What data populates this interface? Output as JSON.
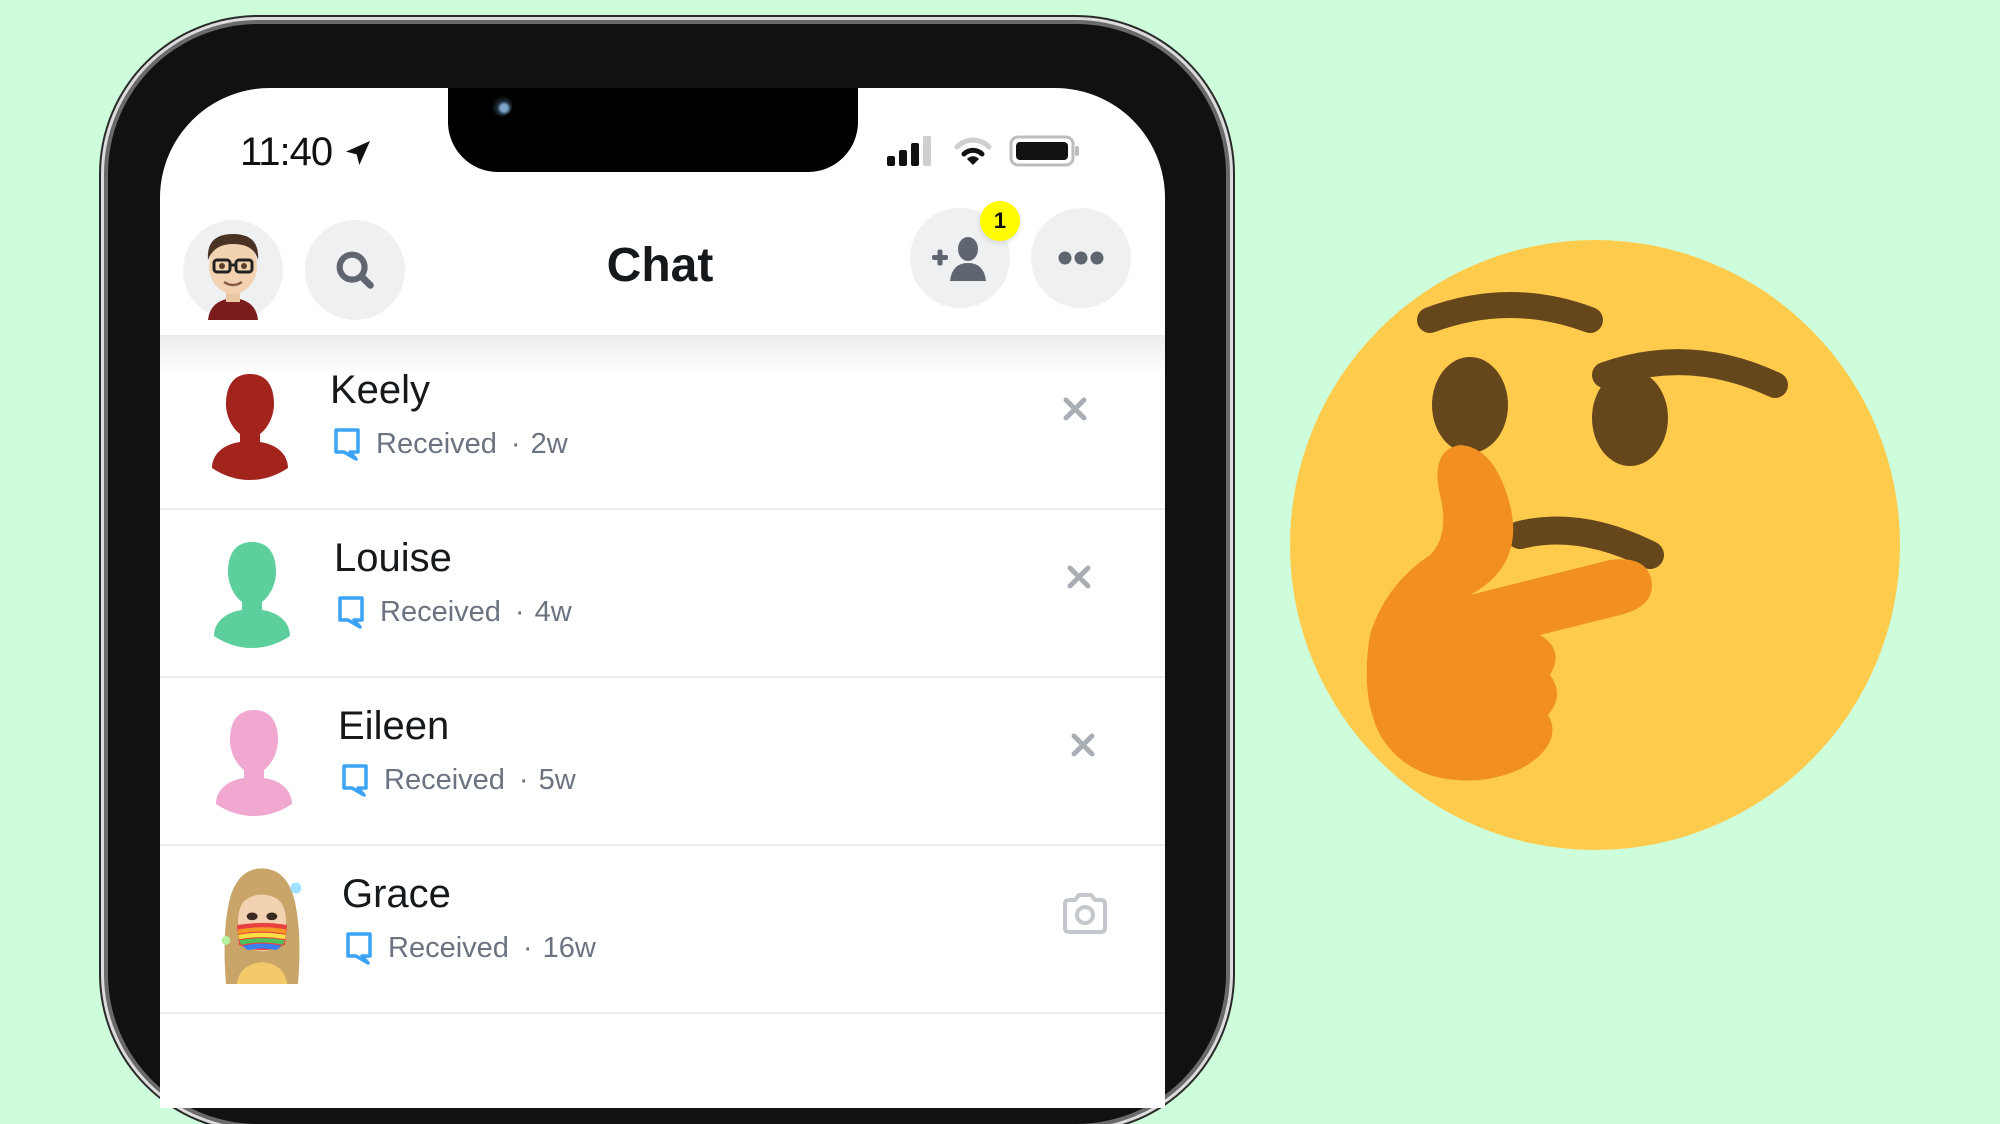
{
  "background_color": "#cdfddb",
  "status_bar": {
    "time": "11:40",
    "location_icon": "location-arrow-icon",
    "signal_icon": "cellular-signal-icon",
    "wifi_icon": "wifi-icon",
    "battery_icon": "battery-icon"
  },
  "header": {
    "title": "Chat",
    "profile_icon": "bitmoji-avatar",
    "search_icon": "search-icon",
    "add_friend_icon": "add-friend-icon",
    "add_friend_badge": "1",
    "more_icon": "more-icon",
    "badge_color": "#fffc00"
  },
  "chats": [
    {
      "name": "Keely",
      "status": "Received",
      "separator": "·",
      "time": "2w",
      "avatar_color": "#a3231d",
      "avatar_type": "silhouette",
      "action": "close-icon"
    },
    {
      "name": "Louise",
      "status": "Received",
      "separator": "·",
      "time": "4w",
      "avatar_color": "#5ccf9c",
      "avatar_type": "silhouette",
      "action": "close-icon"
    },
    {
      "name": "Eileen",
      "status": "Received",
      "separator": "·",
      "time": "5w",
      "avatar_color": "#f0a8d0",
      "avatar_type": "silhouette",
      "action": "close-icon"
    },
    {
      "name": "Grace",
      "status": "Received",
      "separator": "·",
      "time": "16w",
      "avatar_color": "#d6b072",
      "avatar_type": "bitmoji",
      "action": "camera-icon"
    }
  ],
  "status_icon_color": "#3ca3f5",
  "decoration": {
    "emoji": "thinking-face-emoji",
    "face_color": "#ffcb4c",
    "feature_color": "#65471b",
    "hand_color": "#f19020"
  }
}
